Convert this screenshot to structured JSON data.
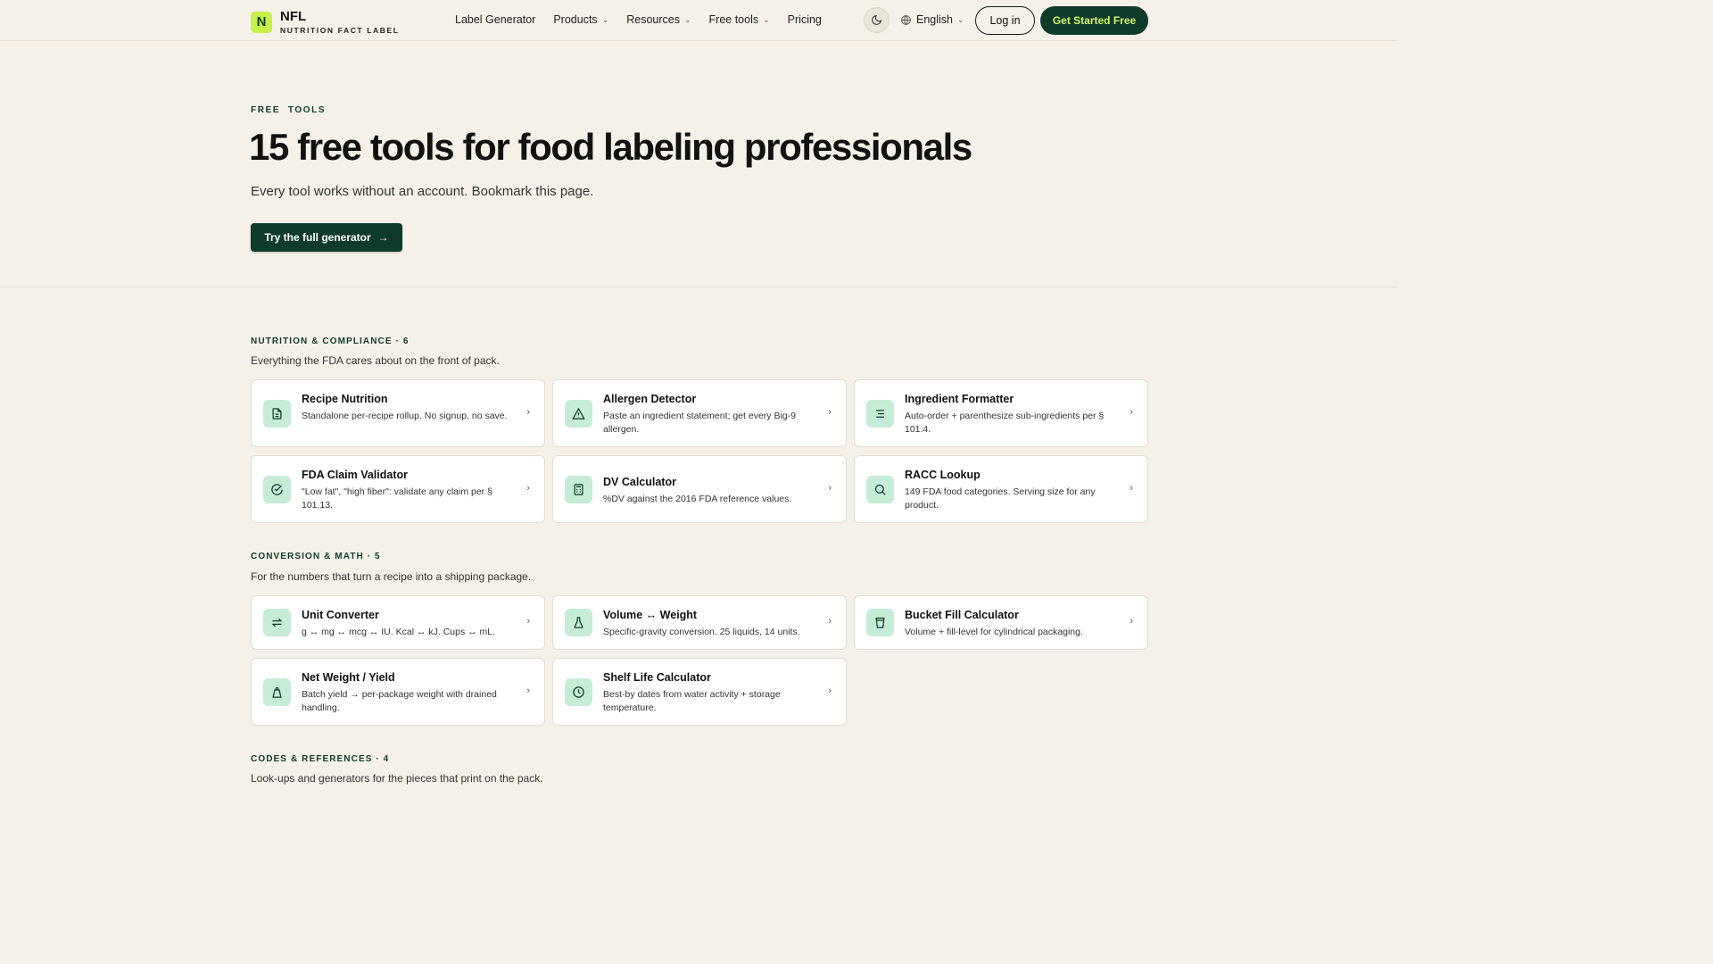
{
  "nav": {
    "logo_mark": "N",
    "logo_name": "NFL",
    "logo_sub": "NUTRITION FACT LABEL",
    "links": [
      {
        "label": "Label Generator",
        "dropdown": false
      },
      {
        "label": "Products",
        "dropdown": true
      },
      {
        "label": "Resources",
        "dropdown": true
      },
      {
        "label": "Free tools",
        "dropdown": true
      },
      {
        "label": "Pricing",
        "dropdown": false
      }
    ],
    "theme_icon": "moon-icon",
    "language": "English",
    "login": "Log in",
    "get_started": "Get Started Free"
  },
  "hero": {
    "eyebrow": "FREE  TOOLS",
    "title": "15 free tools for food labeling professionals",
    "subtitle": "Every tool works without an account. Bookmark this page.",
    "cta": "Try the full generator",
    "cta_arrow": "→"
  },
  "sections": [
    {
      "heading": "NUTRITION & COMPLIANCE · 6",
      "description": "Everything the FDA cares about on the front of pack.",
      "tools": [
        {
          "title": "Recipe Nutrition",
          "desc": "Standalone per-recipe rollup. No signup, no save.",
          "icon": "document-icon"
        },
        {
          "title": "Allergen Detector",
          "desc": "Paste an ingredient statement; get every Big-9 allergen.",
          "icon": "warning-triangle-icon"
        },
        {
          "title": "Ingredient Formatter",
          "desc": "Auto-order + parenthesize sub-ingredients per § 101.4.",
          "icon": "list-icon"
        },
        {
          "title": "FDA Claim Validator",
          "desc": "\"Low fat\", \"high fiber\": validate any claim per § 101.13.",
          "icon": "check-circle-icon"
        },
        {
          "title": "DV Calculator",
          "desc": "%DV against the 2016 FDA reference values.",
          "icon": "calculator-icon"
        },
        {
          "title": "RACC Lookup",
          "desc": "149 FDA food categories. Serving size for any product.",
          "icon": "search-icon"
        }
      ]
    },
    {
      "heading": "CONVERSION & MATH · 5",
      "description": "For the numbers that turn a recipe into a shipping package.",
      "tools": [
        {
          "title": "Unit Converter",
          "desc": "g ↔ mg ↔ mcg ↔ IU. Kcal ↔ kJ. Cups ↔ mL.",
          "icon": "swap-arrows-icon"
        },
        {
          "title": "Volume ↔ Weight",
          "desc": "Specific-gravity conversion. 25 liquids, 14 units.",
          "icon": "flask-icon"
        },
        {
          "title": "Bucket Fill Calculator",
          "desc": "Volume + fill-level for cylindrical packaging.",
          "icon": "bucket-icon"
        },
        {
          "title": "Net Weight / Yield",
          "desc": "Batch yield → per-package weight with drained handling.",
          "icon": "weight-icon"
        },
        {
          "title": "Shelf Life Calculator",
          "desc": "Best-by dates from water activity + storage temperature.",
          "icon": "clock-icon"
        }
      ]
    },
    {
      "heading": "CODES & REFERENCES · 4",
      "description": "Look-ups and generators for the pieces that print on the pack."
    }
  ],
  "colors": {
    "background": "#f5f1e8",
    "brand_dark": "#0f3b2a",
    "brand_lime": "#c7f04a",
    "icon_tile": "#c6ecd6"
  }
}
